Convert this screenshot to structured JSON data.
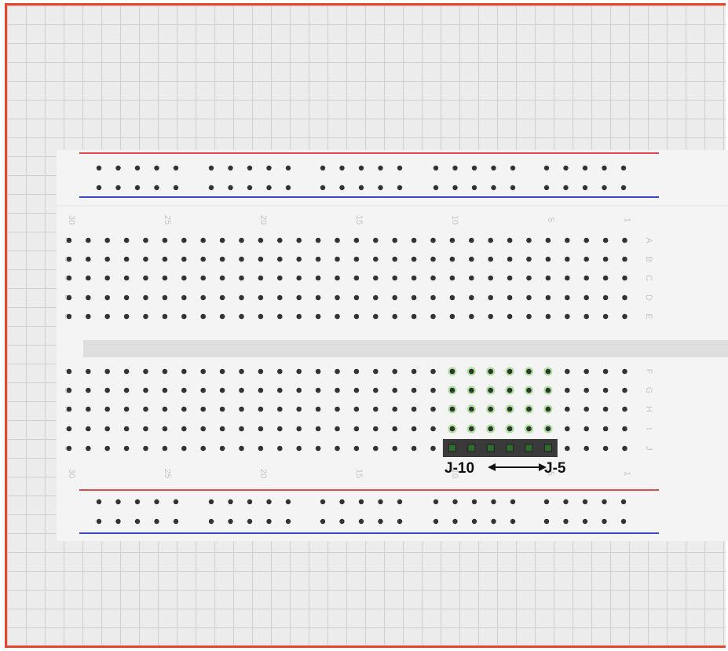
{
  "column_numbers": [
    "30",
    "25",
    "20",
    "15",
    "10",
    "5",
    "1"
  ],
  "row_letters_top": [
    "A",
    "B",
    "C",
    "D",
    "E"
  ],
  "row_letters_bottom": [
    "F",
    "G",
    "H",
    "I",
    "J"
  ],
  "rail_groups": 5,
  "rail_holes_per_group": 5,
  "colors": {
    "canvas_border": "#e8452c",
    "grid": "#cfcfcf",
    "board": "#f4f4f4",
    "channel": "#dedede",
    "hole": "#333333",
    "rail_positive": "#e0494f",
    "rail_negative": "#3b47c4",
    "highlight_hole": "#6ad24a",
    "header_pin_strip": "#3a3a3a",
    "header_pin": "#2f6b2f",
    "label_text": "#c4c4c4"
  },
  "header": {
    "start_label": "J-10",
    "end_label": "J-5",
    "from_column": 10,
    "to_column": 5,
    "pin_row": "J",
    "highlighted_rows": [
      "F",
      "G",
      "H",
      "I"
    ]
  }
}
